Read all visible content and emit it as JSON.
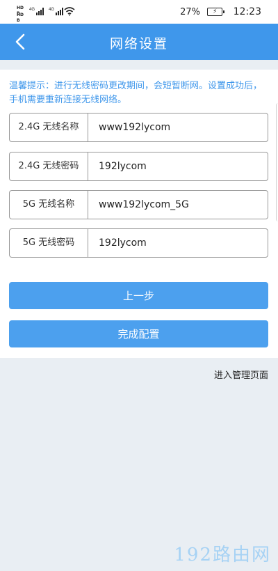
{
  "status_bar": {
    "hd_top": "HD B",
    "hd_bottom": "HD B",
    "net1": "4G",
    "net2": "4G",
    "battery_percent": "27%",
    "time": "12:23"
  },
  "header": {
    "title": "网络设置"
  },
  "tip": "温馨提示：进行无线密码更改期间，会短暂断网。设置成功后，手机需要重新连接无线网络。",
  "fields": [
    {
      "label": "2.4G 无线名称",
      "value": "www192lycom"
    },
    {
      "label": "2.4G 无线密码",
      "value": "192lycom"
    },
    {
      "label": "5G 无线名称",
      "value": "www192lycom_5G"
    },
    {
      "label": "5G 无线密码",
      "value": "192lycom"
    }
  ],
  "buttons": {
    "prev": "上一步",
    "finish": "完成配置"
  },
  "admin_link": "进入管理页面",
  "watermark": "192路由网",
  "colors": {
    "accent": "#3f97eb",
    "button": "#4ca0ee",
    "background": "#e9eef3"
  }
}
